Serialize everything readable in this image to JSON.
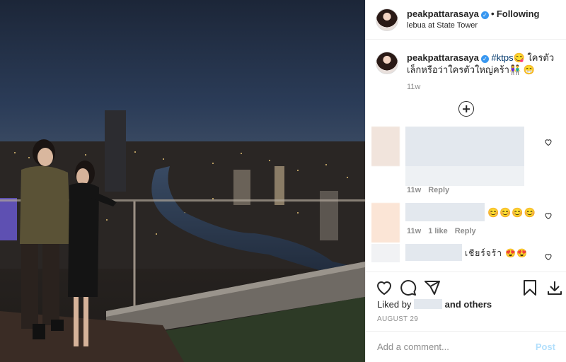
{
  "header": {
    "username": "peakpattarasaya",
    "follow_state": "Following",
    "location": "lebua at State Tower"
  },
  "caption": {
    "username": "peakpattarasaya",
    "hashtag": "#ktps",
    "emoji_1": "😋",
    "text": " ใครตัวเล็กหรือว่าใครตัวใหญ่คร้า",
    "emoji_2": "👫 😁",
    "timestamp": "11w"
  },
  "comments": [
    {
      "time": "11w",
      "likes": "",
      "reply": "Reply"
    },
    {
      "emojis": "😊😊😊😊",
      "time": "11w",
      "likes": "1 like",
      "reply": "Reply"
    },
    {
      "text": "เชียร์จร้า 😍😍"
    }
  ],
  "liked_by": {
    "prefix": "Liked by",
    "suffix": "and others"
  },
  "date": "AUGUST 29",
  "comment_box": {
    "placeholder": "Add a comment...",
    "post_label": "Post"
  },
  "colors": {
    "link": "#00376b",
    "verified": "#3897f0",
    "post_disabled": "#b2dffc",
    "muted": "#8e8e8e"
  }
}
